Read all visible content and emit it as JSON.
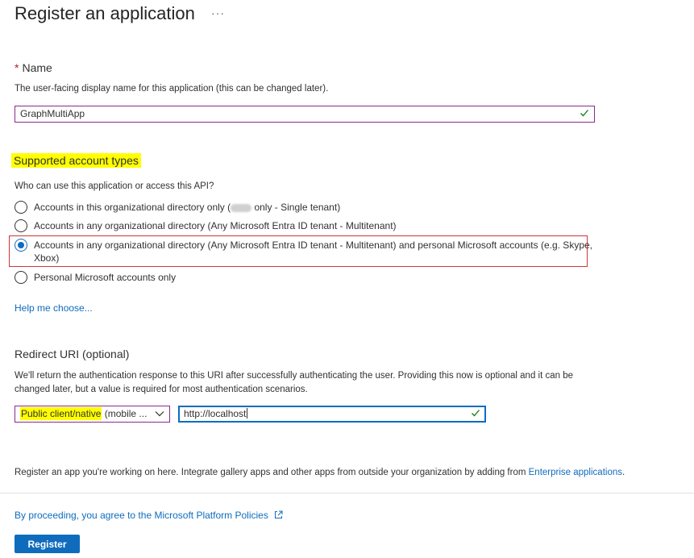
{
  "header": {
    "title": "Register an application",
    "more_label": "···"
  },
  "name_section": {
    "required_star": "*",
    "label": "Name",
    "description": "The user-facing display name for this application (this can be changed later).",
    "value": "GraphMultiApp"
  },
  "account_types": {
    "label": "Supported account types",
    "question": "Who can use this application or access this API?",
    "options": [
      {
        "label_before": "Accounts in this organizational directory only (",
        "label_after": " only - Single tenant)",
        "selected": false
      },
      {
        "label": "Accounts in any organizational directory (Any Microsoft Entra ID tenant - Multitenant)",
        "selected": false
      },
      {
        "label": "Accounts in any organizational directory (Any Microsoft Entra ID tenant - Multitenant) and personal Microsoft accounts (e.g. Skype,",
        "label_line2": "Xbox)",
        "selected": true
      },
      {
        "label": "Personal Microsoft accounts only",
        "selected": false
      }
    ],
    "help_link": "Help me choose..."
  },
  "redirect": {
    "label": "Redirect URI (optional)",
    "description_line1": "We'll return the authentication response to this URI after successfully authenticating the user. Providing this now is optional and it can be",
    "description_line2": "changed later, but a value is required for most authentication scenarios.",
    "platform_highlight": "Public client/native",
    "platform_rest": " (mobile ...",
    "uri_value": "http://localhost"
  },
  "footer": {
    "register_text": "Register an app you're working on here. Integrate gallery apps and other apps from outside your organization by adding from ",
    "enterprise_link": "Enterprise applications",
    "register_text_end": ".",
    "policy_link": "By proceeding, you agree to the Microsoft Platform Policies",
    "register_button": "Register"
  },
  "colors": {
    "accent": "#0f6cbd",
    "highlight": "#ffff00",
    "annotation_red": "#d13438",
    "valid_green": "#107c10"
  }
}
